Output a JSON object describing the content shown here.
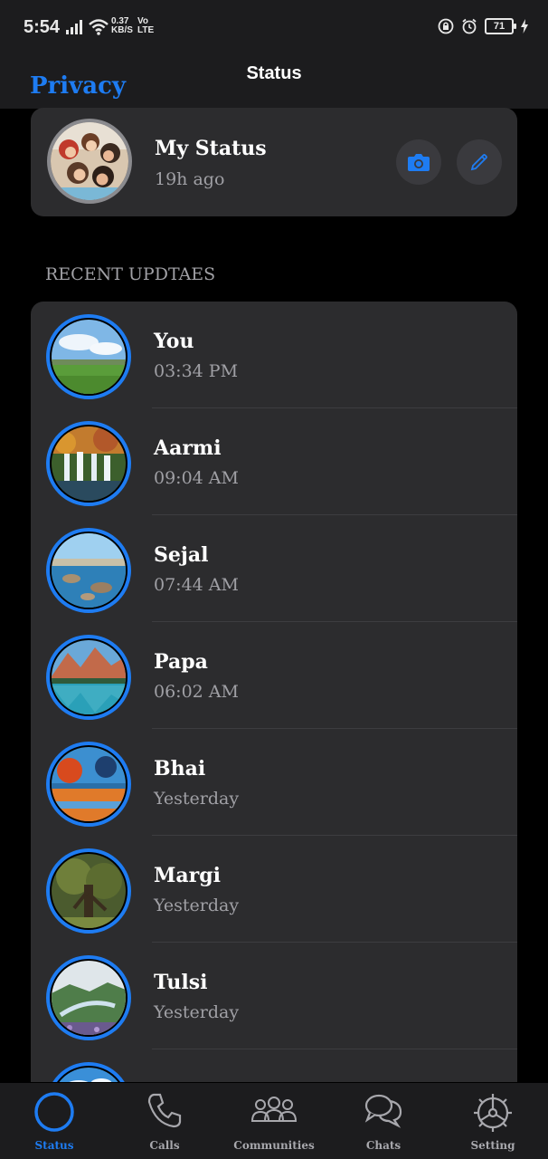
{
  "status_bar": {
    "time": "5:54",
    "net_speed_top": "0.37",
    "net_speed_bottom": "KB/S",
    "volte_top": "Vo",
    "volte_bottom": "LTE",
    "battery": "71"
  },
  "header": {
    "back_label": "Privacy",
    "title": "Status"
  },
  "my_status": {
    "name": "My Status",
    "time": "19h ago",
    "camera_icon": "camera-icon",
    "edit_icon": "pencil-icon"
  },
  "section_label": "RECENT UPDTAES",
  "updates": [
    {
      "name": "You",
      "time": "03:34 PM",
      "thumb": "meadow"
    },
    {
      "name": "Aarmi",
      "time": "09:04 AM",
      "thumb": "waterfall"
    },
    {
      "name": "Sejal",
      "time": "07:44 AM",
      "thumb": "lake-rocks"
    },
    {
      "name": "Papa",
      "time": "06:02 AM",
      "thumb": "mountain-lake"
    },
    {
      "name": "Bhai",
      "time": "Yesterday",
      "thumb": "autumn-park"
    },
    {
      "name": "Margi",
      "time": "Yesterday",
      "thumb": "forest"
    },
    {
      "name": "Tulsi",
      "time": "Yesterday",
      "thumb": "valley-river"
    },
    {
      "name": "",
      "time": "",
      "thumb": "sky"
    }
  ],
  "tabs": [
    {
      "label": "Status",
      "icon": "circle-icon",
      "active": true
    },
    {
      "label": "Calls",
      "icon": "phone-icon",
      "active": false
    },
    {
      "label": "Communities",
      "icon": "people-icon",
      "active": false
    },
    {
      "label": "Chats",
      "icon": "chat-bubbles-icon",
      "active": false
    },
    {
      "label": "Setting",
      "icon": "gear-icon",
      "active": false
    }
  ],
  "colors": {
    "accent": "#1e7cf2",
    "card": "#2c2c2e",
    "bar": "#1c1c1e"
  }
}
